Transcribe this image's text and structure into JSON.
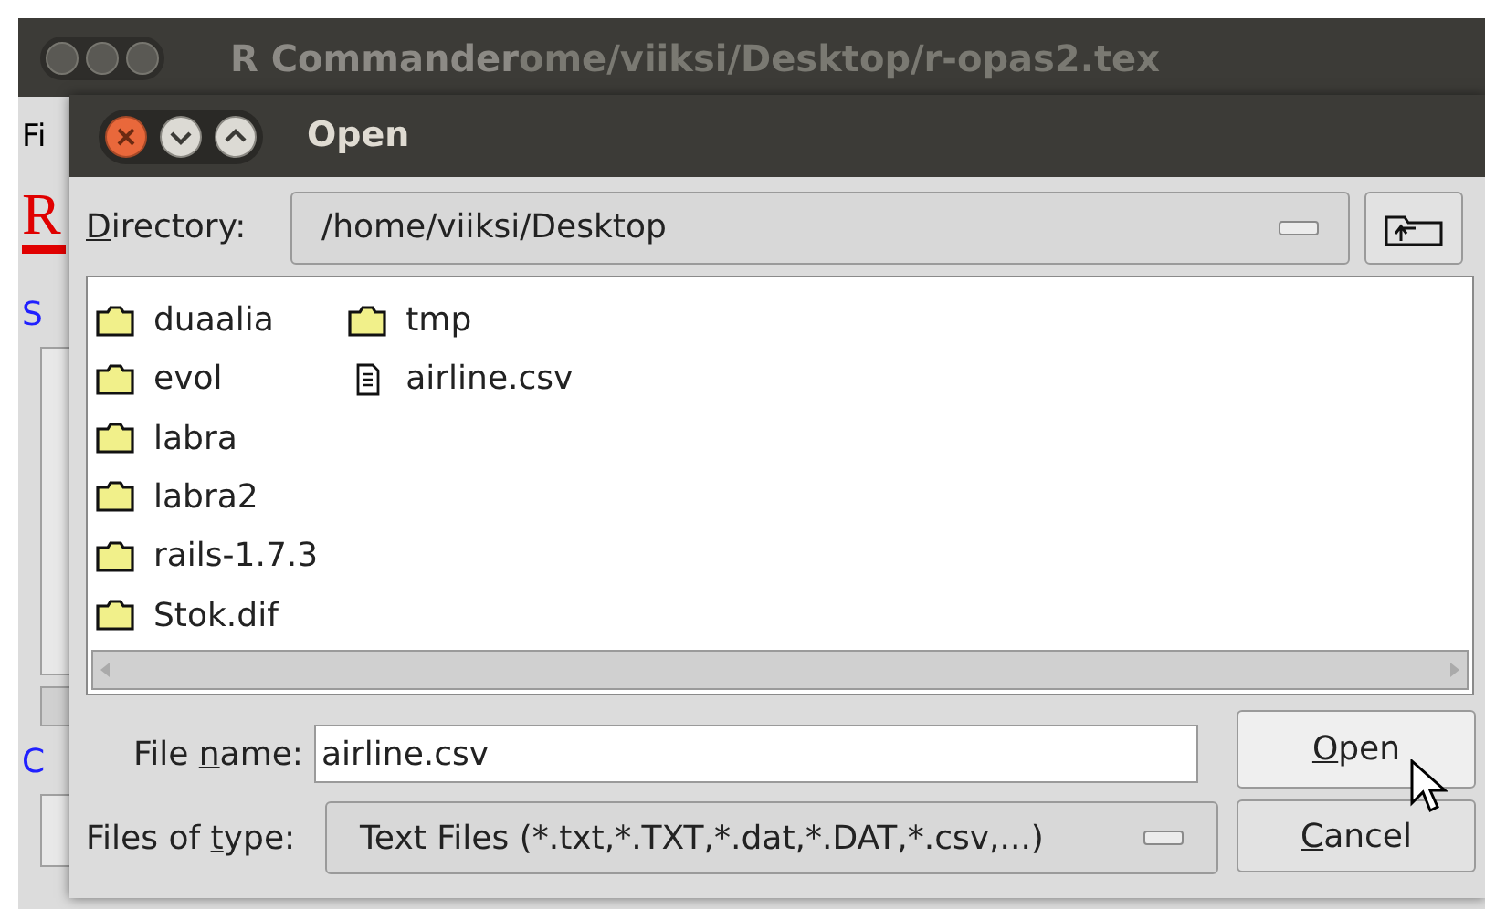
{
  "background_window": {
    "title": "R Commander",
    "title_faded": "ome/viiksi/Desktop/r-opas2.tex",
    "menu_fragment": "Fi",
    "logo": "R",
    "label_fragments": [
      "S",
      "C"
    ]
  },
  "dialog": {
    "title": "Open",
    "directory": {
      "label": {
        "key": "D",
        "post": "irectory:"
      },
      "value": "/home/viiksi/Desktop"
    },
    "files": [
      {
        "name": "duaalia",
        "kind": "folder"
      },
      {
        "name": "evol",
        "kind": "folder"
      },
      {
        "name": "labra",
        "kind": "folder"
      },
      {
        "name": "labra2",
        "kind": "folder"
      },
      {
        "name": "rails-1.7.3",
        "kind": "folder"
      },
      {
        "name": "Stok.dif",
        "kind": "folder"
      },
      {
        "name": "tmp",
        "kind": "folder"
      },
      {
        "name": "airline.csv",
        "kind": "file"
      }
    ],
    "file_name": {
      "label": {
        "pre": "File ",
        "key": "n",
        "post": "ame:"
      },
      "value": "airline.csv"
    },
    "file_type": {
      "label": {
        "pre": "Files of ",
        "key": "t",
        "post": "ype:"
      },
      "value": "Text Files (*.txt,*.TXT,*.dat,*.DAT,*.csv,...)"
    },
    "buttons": [
      {
        "label": {
          "key": "O",
          "post": "pen"
        },
        "hovered": true
      },
      {
        "label": {
          "key": "C",
          "post": "ancel"
        },
        "hovered": false
      }
    ]
  }
}
